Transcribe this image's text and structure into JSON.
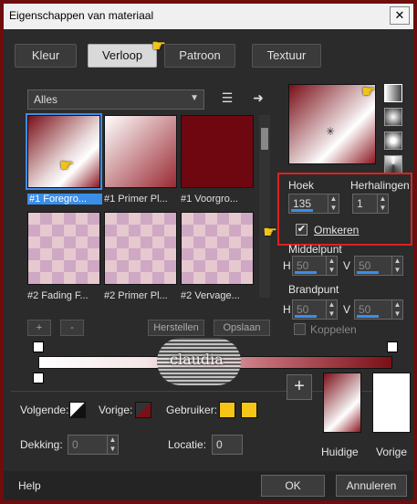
{
  "window": {
    "title": "Eigenschappen van materiaal",
    "close": "✕"
  },
  "tabs": [
    {
      "label": "Kleur",
      "active": false
    },
    {
      "label": "Verloop",
      "active": true
    },
    {
      "label": "Patroon",
      "active": false
    },
    {
      "label": "Textuur",
      "active": false
    }
  ],
  "gallery": {
    "category": "Alles",
    "items": [
      {
        "label": "#1 Foregro...",
        "selected": true,
        "fill": "g1"
      },
      {
        "label": "#1 Primer Pl...",
        "selected": false,
        "fill": "g2"
      },
      {
        "label": "#1 Voorgro...",
        "selected": false,
        "fill": "g3"
      },
      {
        "label": "#2 Fading F...",
        "selected": false,
        "fill": "checker"
      },
      {
        "label": "#2 Primer Pl...",
        "selected": false,
        "fill": "checker"
      },
      {
        "label": "#2 Vervage...",
        "selected": false,
        "fill": "checker"
      }
    ],
    "add": "+",
    "remove": "-",
    "restore": "Herstellen",
    "save": "Opslaan"
  },
  "settings": {
    "angle_label": "Hoek",
    "angle_value": "135",
    "repeats_label": "Herhalingen",
    "repeats_value": "1",
    "invert_label": "Omkeren",
    "invert_checked": true,
    "center_label": "Middelpunt",
    "center_h_label": "H",
    "center_h": "50",
    "center_v_label": "V",
    "center_v": "50",
    "focal_label": "Brandpunt",
    "focal_h_label": "H",
    "focal_h": "50",
    "focal_v_label": "V",
    "focal_v": "50",
    "link_label": "Koppelen"
  },
  "bottom": {
    "next_label": "Volgende:",
    "prev_label": "Vorige:",
    "user_label": "Gebruiker:",
    "opacity_label": "Dekking:",
    "opacity_value": "0",
    "location_label": "Locatie:",
    "location_value": "0",
    "current_label": "Huidige",
    "previous_label": "Vorige",
    "plus": "+"
  },
  "footer": {
    "help": "Help",
    "ok": "OK",
    "cancel": "Annuleren"
  },
  "watermark": "claudia",
  "colors": {
    "accent": "#3b8ee8",
    "highlight": "#e02020",
    "user_swatch": "#f5c518",
    "dark_red": "#7a0f17"
  }
}
